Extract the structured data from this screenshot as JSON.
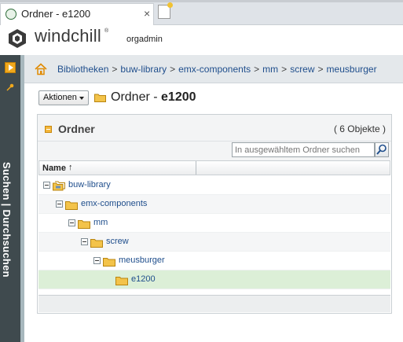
{
  "browser": {
    "tab_title": "Ordner - e1200",
    "close_glyph": "×"
  },
  "app": {
    "logo_text": "windchill",
    "logo_tm": "®",
    "username": "orgadmin"
  },
  "rail": {
    "label": "Suchen | Durchsuchen"
  },
  "breadcrumb": {
    "separator": ">",
    "items": [
      "Bibliotheken",
      "buw-library",
      "emx-components",
      "mm",
      "screw",
      "meusburger"
    ]
  },
  "toolbar": {
    "actions_label": "Aktionen"
  },
  "page": {
    "title_prefix": "Ordner - ",
    "title_name": "e1200"
  },
  "panel": {
    "title": "Ordner",
    "count": "( 6 Objekte )",
    "search_placeholder": "In ausgewähltem Ordner suchen",
    "column_name": "Name",
    "sort_glyph": "↑"
  },
  "tree": [
    {
      "label": "buw-library",
      "level": 0,
      "icon": "library-folder-icon",
      "expander": true
    },
    {
      "label": "emx-components",
      "level": 1,
      "icon": "folder-icon",
      "expander": true
    },
    {
      "label": "mm",
      "level": 2,
      "icon": "folder-icon",
      "expander": true
    },
    {
      "label": "screw",
      "level": 3,
      "icon": "folder-icon",
      "expander": true
    },
    {
      "label": "meusburger",
      "level": 4,
      "icon": "folder-icon",
      "expander": true
    },
    {
      "label": "e1200",
      "level": 5,
      "icon": "folder-icon",
      "expander": false,
      "selected": true
    }
  ],
  "colors": {
    "rail": "#3f4a4e",
    "accent_orange": "#f0a81c",
    "link": "#1f4e8c",
    "selected_row": "#dcefd7"
  }
}
